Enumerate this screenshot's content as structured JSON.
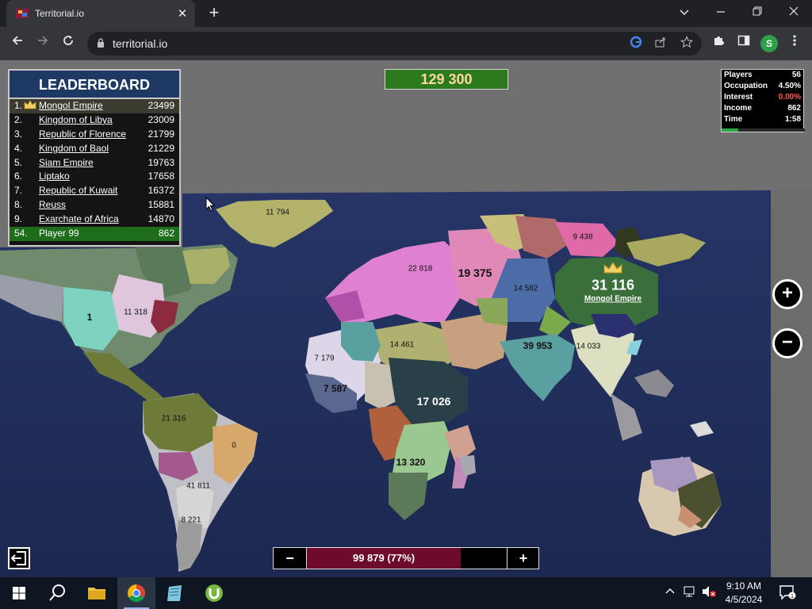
{
  "browser": {
    "tab_title": "Territorial.io",
    "url": "territorial.io",
    "profile_initial": "S",
    "new_tab": "+",
    "tab_close": "✕"
  },
  "leaderboard": {
    "title": "LEADERBOARD",
    "rows": [
      {
        "rank": "1.",
        "name": "Mongol Empire",
        "score": "23499"
      },
      {
        "rank": "2.",
        "name": "Kingdom of Libya",
        "score": "23009"
      },
      {
        "rank": "3.",
        "name": "Republic of Florence",
        "score": "21799"
      },
      {
        "rank": "4.",
        "name": "Kingdom of Baol",
        "score": "21229"
      },
      {
        "rank": "5.",
        "name": "Siam Empire",
        "score": "19763"
      },
      {
        "rank": "6.",
        "name": "Liptako",
        "score": "17658"
      },
      {
        "rank": "7.",
        "name": "Republic of Kuwait",
        "score": "16372"
      },
      {
        "rank": "8.",
        "name": "Reuss",
        "score": "15881"
      },
      {
        "rank": "9.",
        "name": "Exarchate of Africa",
        "score": "14870"
      }
    ],
    "player": {
      "rank": "54.",
      "name": "Player 99",
      "score": "862"
    }
  },
  "balance": "129 300",
  "stats": {
    "rows": [
      {
        "label": "Players",
        "value": "56",
        "color": "#ffffff"
      },
      {
        "label": "Occupation",
        "value": "4.50%",
        "color": "#ffffff"
      },
      {
        "label": "Interest",
        "value": "0.00%",
        "color": "#ff5a5a"
      },
      {
        "label": "Income",
        "value": "862",
        "color": "#ffffff"
      },
      {
        "label": "Time",
        "value": "1:58",
        "color": "#ffffff"
      }
    ],
    "progress_fraction": 0.2
  },
  "map_labels": {
    "greenland": "11 794",
    "nw_canada": "11 318",
    "mexico": "1",
    "europe_west": "22 818",
    "russia": "19 375",
    "siberia_east": "9 438",
    "central_asia": "14 582",
    "mongol_score": "31 116",
    "mongol_name": "Mongol Empire",
    "middle_east": "14 461",
    "india": "39 953",
    "se_asia": "14 033",
    "nw_africa": "7 179",
    "w_africa": "7 587",
    "central_africa": "17 026",
    "east_africa": "13 320",
    "brazil_north": "21 316",
    "brazil_east": "0",
    "south_america_mid": "41 811",
    "argentina": "8 221"
  },
  "controls": {
    "zoom_in": "+",
    "zoom_out": "−",
    "troop_minus": "−",
    "troop_plus": "+",
    "troop_value": "99 879 (77%)",
    "troop_fraction": 0.77
  },
  "taskbar": {
    "time": "9:10 AM",
    "date": "4/5/2024"
  },
  "colors": {
    "ocean": "#23305a",
    "leaderboard_header": "#1e3a64",
    "balance_bg": "#2c7a1e",
    "troop_fill": "#6e0a2c",
    "player_row": "#1d6d1a"
  }
}
